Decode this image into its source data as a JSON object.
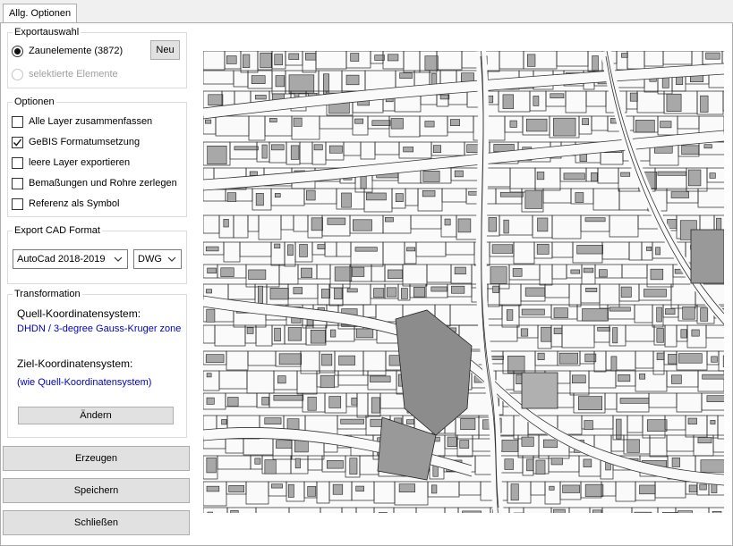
{
  "tab": {
    "label": "Allg. Optionen"
  },
  "export_selection": {
    "legend": "Exportauswahl",
    "option_fence": "Zaunelemente (3872)",
    "option_selected": "selektierte Elemente",
    "new_button": "Neu"
  },
  "options": {
    "legend": "Optionen",
    "items": [
      {
        "label": "Alle Layer zusammenfassen",
        "checked": false
      },
      {
        "label": "GeBIS Formatumsetzung",
        "checked": true
      },
      {
        "label": "leere Layer exportieren",
        "checked": false
      },
      {
        "label": "Bemaßungen und Rohre zerlegen",
        "checked": false
      },
      {
        "label": "Referenz als Symbol",
        "checked": false
      }
    ]
  },
  "export_format": {
    "legend": "Export CAD Format",
    "version": "AutoCad 2018-2019",
    "filetype": "DWG"
  },
  "transformation": {
    "legend": "Transformation",
    "source_label": "Quell-Koordinatensystem:",
    "source_value": "DHDN / 3-degree Gauss-Kruger zone",
    "target_label": "Ziel-Koordinatensystem:",
    "target_value": "(wie Quell-Koordinatensystem)",
    "change_button": "Ändern"
  },
  "actions": {
    "create": "Erzeugen",
    "save": "Speichern",
    "close": "Schließen"
  },
  "icons": {
    "check": "checkmark-icon",
    "chevron": "chevron-down-icon"
  }
}
